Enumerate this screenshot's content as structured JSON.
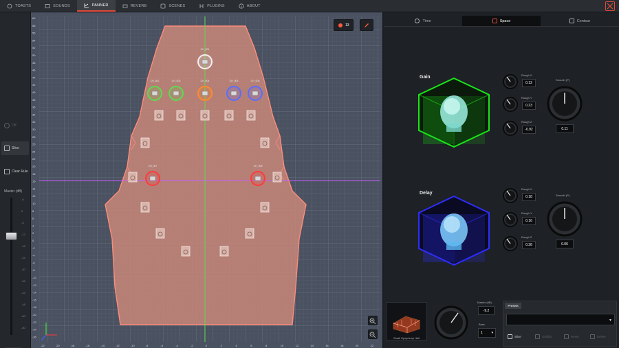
{
  "nav": {
    "tabs": [
      {
        "label": "TOASTS",
        "icon": "connect-icon"
      },
      {
        "label": "SOUNDS",
        "icon": "image-icon"
      },
      {
        "label": "PANNER",
        "icon": "panner-icon",
        "active": true
      },
      {
        "label": "REVERB",
        "icon": "reverb-icon"
      },
      {
        "label": "SCENES",
        "icon": "scenes-icon"
      },
      {
        "label": "PLUGINS",
        "icon": "plugins-icon"
      },
      {
        "label": "ABOUT",
        "icon": "info-icon"
      }
    ]
  },
  "left": {
    "buttons": [
      {
        "label": "Off",
        "state": "disabled"
      },
      {
        "label": "Slice",
        "state": "selected"
      },
      {
        "label": "Clear Rule",
        "state": "normal"
      }
    ],
    "master_label": "Master (dB)",
    "fader_ticks": [
      "-6",
      "0",
      "-6",
      "-12",
      "-18",
      "-24",
      "-30",
      "-36",
      "-42",
      "-48",
      "-60",
      "-80"
    ],
    "mute_symbol": "◀)"
  },
  "stage": {
    "top_buttons": [
      {
        "label": "13",
        "icon": "record-icon"
      },
      {
        "label": "",
        "icon": "pencil-icon"
      }
    ],
    "y_ticks": [
      "60",
      "58",
      "56",
      "54",
      "52",
      "50",
      "48",
      "46",
      "44",
      "42",
      "40",
      "38",
      "36",
      "34",
      "32",
      "30",
      "28",
      "26",
      "24",
      "22",
      "20",
      "18",
      "16",
      "14",
      "12",
      "10",
      "8",
      "6",
      "4",
      "2",
      "0",
      "-2",
      "-4",
      "-6",
      "-8",
      "-10",
      "-12",
      "-14",
      "-16",
      "-18",
      "-20",
      "-22",
      "-24",
      "-26"
    ],
    "x_ticks": [
      "-22",
      "-20",
      "-18",
      "-16",
      "-14",
      "-12",
      "-10",
      "-8",
      "-6",
      "-4",
      "-2",
      "0",
      "2",
      "4",
      "6",
      "8",
      "10",
      "12",
      "14",
      "16",
      "18",
      "20",
      "22"
    ],
    "speaker_labels": [
      "CH_001",
      "CH_002",
      "CH_003",
      "CH_004",
      "CH_005",
      "CH_006",
      "CH_007",
      "CH_008"
    ],
    "colors": {
      "stage_bg": "#4a5160",
      "room_fill": "#c8877a",
      "room_edge": "#ff8c7a",
      "axis_h": "#c85cff",
      "axis_v": "#5fd94f",
      "src_white": "#f2f2f2",
      "src_green": "#5fd94f",
      "src_orange": "#ff8a2a",
      "src_blue": "#5a6dff",
      "src_red": "#ff3b3b"
    }
  },
  "right": {
    "tabs": [
      {
        "label": "Time",
        "icon": "clock-icon"
      },
      {
        "label": "Space",
        "icon": "space-icon",
        "active": true
      },
      {
        "label": "Contour",
        "icon": "contour-icon"
      }
    ],
    "gain": {
      "title": "Gain",
      "knobs": [
        {
          "label": "Rough X",
          "value": "0.12"
        },
        {
          "label": "Rough Y",
          "value": "0.23"
        },
        {
          "label": "Rough Z",
          "value": "-0.92"
        }
      ],
      "big_label": "Smooth (P)",
      "big_value": "0.11",
      "cube_color": "#19e619"
    },
    "delay": {
      "title": "Delay",
      "knobs": [
        {
          "label": "Rough X",
          "value": "0.18"
        },
        {
          "label": "Rough Y",
          "value": "0.16"
        },
        {
          "label": "Rough Z",
          "value": "0.28"
        }
      ],
      "big_label": "Smooth (P)",
      "big_value": "0.06",
      "cube_color": "#2e2eff"
    },
    "bottom": {
      "room_label": "Small Symphony Hall",
      "master_label": "Master (dB)",
      "master_value": "-9.2",
      "bass_label": "Bass",
      "bass_value": "1",
      "presets_tab": "Presets",
      "preset_buttons": [
        {
          "label": "Slice",
          "enabled": true
        },
        {
          "label": "Solidify",
          "enabled": false
        },
        {
          "label": "Reset",
          "enabled": false
        },
        {
          "label": "Delete",
          "enabled": false
        }
      ]
    }
  }
}
